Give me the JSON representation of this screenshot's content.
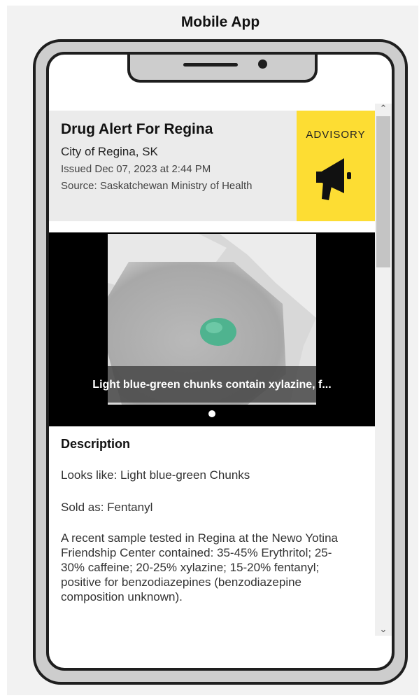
{
  "mockup": {
    "title": "Mobile App"
  },
  "alert": {
    "title": "Drug Alert For Regina",
    "city": "City of Regina, SK",
    "issued": "Issued Dec 07, 2023 at 2:44 PM",
    "source": "Source: Saskatchewan Ministry of Health",
    "badge_label": "ADVISORY",
    "badge_icon": "megaphone-icon",
    "badge_color": "#fddd33"
  },
  "carousel": {
    "caption": "Light blue-green chunks contain xylazine, f...",
    "page_count": 1,
    "active_page": 1
  },
  "description": {
    "heading": "Description",
    "looks_like": "Looks like: Light blue-green Chunks",
    "sold_as": "Sold as: Fentanyl",
    "body": "A recent sample tested in Regina at the Newo Yotina Friendship Center contained: 35-45% Erythritol; 25-30% caffeine; 20-25% xylazine; 15-20% fentanyl; positive for benzodiazepines (benzodiazepine composition unknown)."
  },
  "scrollbar": {
    "up_icon": "chevron-up-icon",
    "down_icon": "chevron-down-icon"
  }
}
